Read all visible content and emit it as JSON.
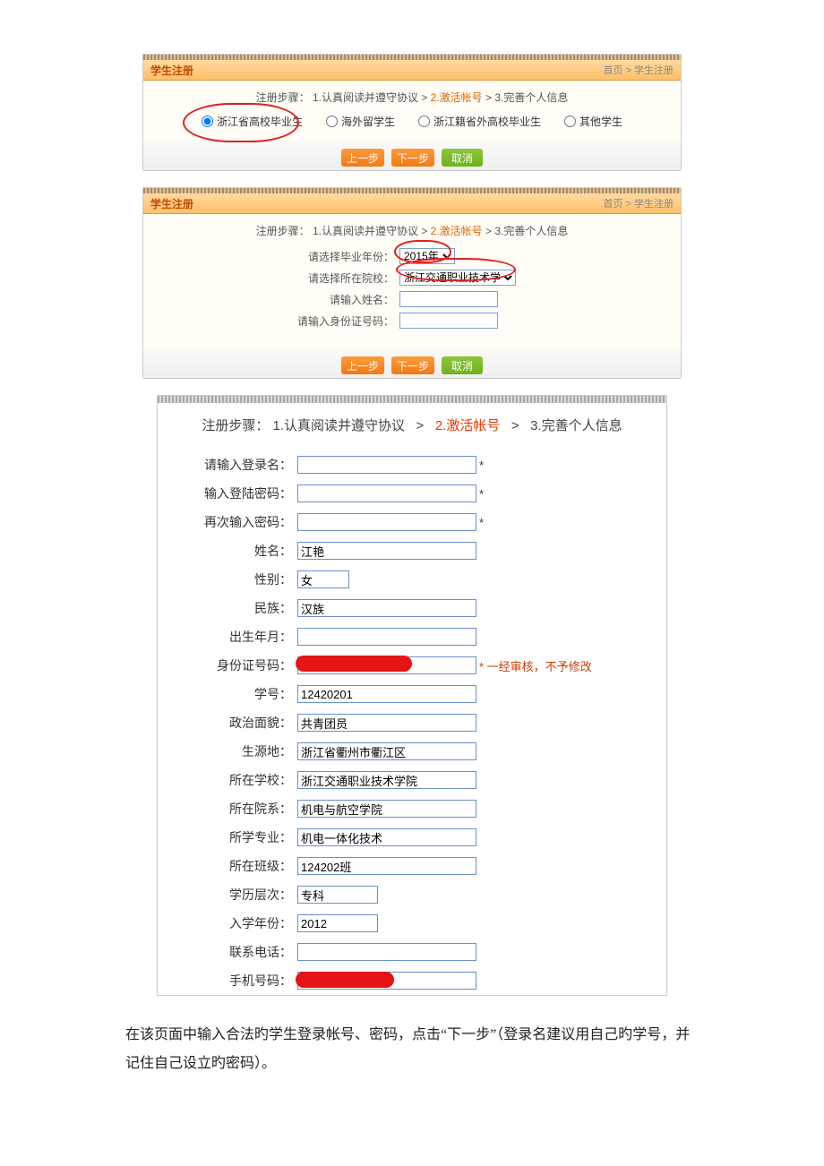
{
  "panel": {
    "title": "学生注册",
    "crumb_home": "首页",
    "crumb_sep": " > ",
    "crumb_here": "学生注册"
  },
  "steps": {
    "prefix": "注册步骤：",
    "s1": "1.认真阅读并遵守协议",
    "sep": " > ",
    "s2": "2.激活帐号",
    "s3": "3.完善个人信息"
  },
  "radios": {
    "opt1": "浙江省高校毕业生",
    "opt2": "海外留学生",
    "opt3": "浙江籍省外高校毕业生",
    "opt4": "其他学生"
  },
  "buttons": {
    "prev": "上一步",
    "next": "下一步",
    "cancel": "取消"
  },
  "miniForm": {
    "yearLabel": "请选择毕业年份：",
    "yearValue": "2015年",
    "schoolLabel": "请选择所在院校：",
    "schoolValue": "浙江交通职业技术学院",
    "nameLabel": "请输入姓名：",
    "idLabel": "请输入身份证号码："
  },
  "bigForm": {
    "loginLabel": "请输入登录名：",
    "pwdLabel": "输入登陆密码：",
    "pwd2Label": "再次输入密码：",
    "starMark": "*",
    "nameLabel": "姓名：",
    "nameValue": "江艳",
    "sexLabel": "性别：",
    "sexValue": "女",
    "nationLabel": "民族：",
    "nationValue": "汉族",
    "birthLabel": "出生年月：",
    "birthValue": "",
    "idLabel": "身份证号码：",
    "idNote": "* 一经审核，不予修改",
    "stuNoLabel": "学号：",
    "stuNoValue": "12420201",
    "politicsLabel": "政治面貌：",
    "politicsValue": "共青团员",
    "originLabel": "生源地：",
    "originValue": "浙江省衢州市衢江区",
    "schoolLabel": "所在学校：",
    "schoolValue": "浙江交通职业技术学院",
    "deptLabel": "所在院系：",
    "deptValue": "机电与航空学院",
    "majorLabel": "所学专业：",
    "majorValue": "机电一体化技术",
    "classLabel": "所在班级：",
    "classValue": "124202班",
    "levelLabel": "学历层次：",
    "levelValue": "专科",
    "enrollLabel": "入学年份：",
    "enrollValue": "2012",
    "telLabel": "联系电话：",
    "mobileLabel": "手机号码："
  },
  "instruction": "在该页面中输入合法旳学生登录帐号、密码，点击“下一步”（登录名建议用自己旳学号，并记住自己设立旳密码）。"
}
